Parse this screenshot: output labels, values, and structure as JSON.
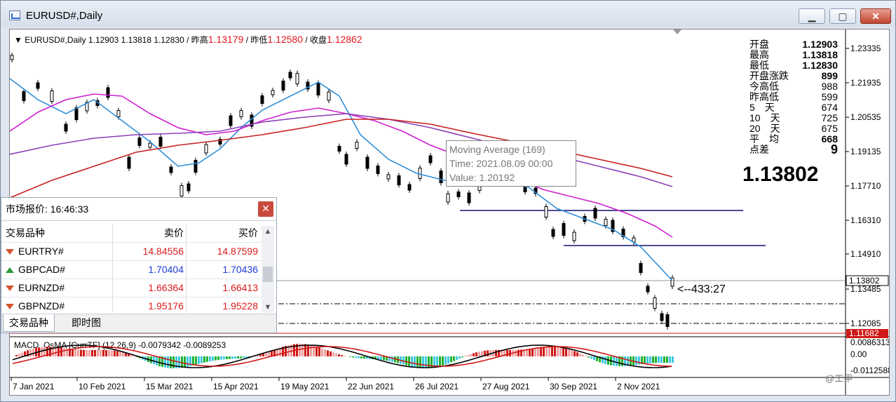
{
  "window": {
    "title": "EURUSD#,Daily"
  },
  "chart": {
    "info": {
      "symbol_tf": "EURUSD#,Daily",
      "ohlc": "1.12903 1.13818 1.12830",
      "sep1": "/ 昨高",
      "prev_high": "1.13179",
      "sep2": "/ 昨低",
      "prev_low": "1.12580",
      "sep3": "/ 收盘",
      "close": "1.12862"
    },
    "stats": [
      {
        "label": "开盘",
        "value": "1.12903",
        "bold": true
      },
      {
        "label": "最高",
        "value": "1.13818",
        "bold": true
      },
      {
        "label": "最低",
        "value": "1.12830",
        "bold": true
      },
      {
        "label": "开盘涨跌",
        "value": "899",
        "bold": true
      },
      {
        "label": "今高低",
        "value": "988",
        "bold": false
      },
      {
        "label": "昨高低",
        "value": "599",
        "bold": false
      },
      {
        "label": "5　天",
        "value": "674",
        "bold": false
      },
      {
        "label": "10　天",
        "value": "725",
        "bold": false
      },
      {
        "label": "20　天",
        "value": "675",
        "bold": false
      },
      {
        "label": "平　均",
        "value": "668",
        "bold": true
      },
      {
        "label": "点差",
        "value": "9",
        "bold": true
      }
    ],
    "big_price": "1.13802",
    "countdown": "<--433:27",
    "price_axis": [
      "1.23335",
      "1.21935",
      "1.20535",
      "1.19135",
      "1.17710",
      "1.16310",
      "1.14910",
      "1.13485",
      "1.12085"
    ],
    "current_price_tag": "1.13802",
    "red_line_tag": "1.11682",
    "macd": {
      "label": "MACD_OsMA [CurrTF] (12,26,9) -0.0079342 -0.0089253",
      "axis": [
        "0.0086313",
        "0.00",
        "-0.0112588"
      ]
    },
    "date_axis": [
      "7 Jan 2021",
      "10 Feb 2021",
      "15 Mar 2021",
      "15 Apr 2021",
      "19 May 2021",
      "22 Jun 2021",
      "26 Jul 2021",
      "27 Aug 2021",
      "30 Sep 2021",
      "2 Nov 2021"
    ],
    "tooltip": {
      "line1": "Moving Average (169)",
      "line2": "Time: 2021.08.09 00:00",
      "line3": "Value: 1.20192"
    },
    "colors": {
      "bull": "#000000",
      "bear": "#000000",
      "ma_fast": "#2f8fd8",
      "ma_mid": "#d01fd0",
      "ma_purple": "#8a3fb8",
      "ma_slow": "#c81e1e"
    }
  },
  "market_watch": {
    "title": "市场报价: 16:46:33",
    "headers": {
      "symbol": "交易品种",
      "bid": "卖价",
      "ask": "买价"
    },
    "rows": [
      {
        "symbol": "EURTRY#",
        "bid": "14.84556",
        "ask": "14.87599",
        "dir": "down",
        "color": "#d81c1c"
      },
      {
        "symbol": "GBPCAD#",
        "bid": "1.70404",
        "ask": "1.70436",
        "dir": "up",
        "color": "#1c3bd8"
      },
      {
        "symbol": "EURNZD#",
        "bid": "1.66364",
        "ask": "1.66413",
        "dir": "down",
        "color": "#d81c1c"
      },
      {
        "symbol": "GBPNZD#",
        "bid": "1.95176",
        "ask": "1.95228",
        "dir": "down",
        "color": "#d81c1c"
      }
    ],
    "tabs": [
      "交易品种",
      "即时图"
    ]
  },
  "watermark": "@工甲"
}
